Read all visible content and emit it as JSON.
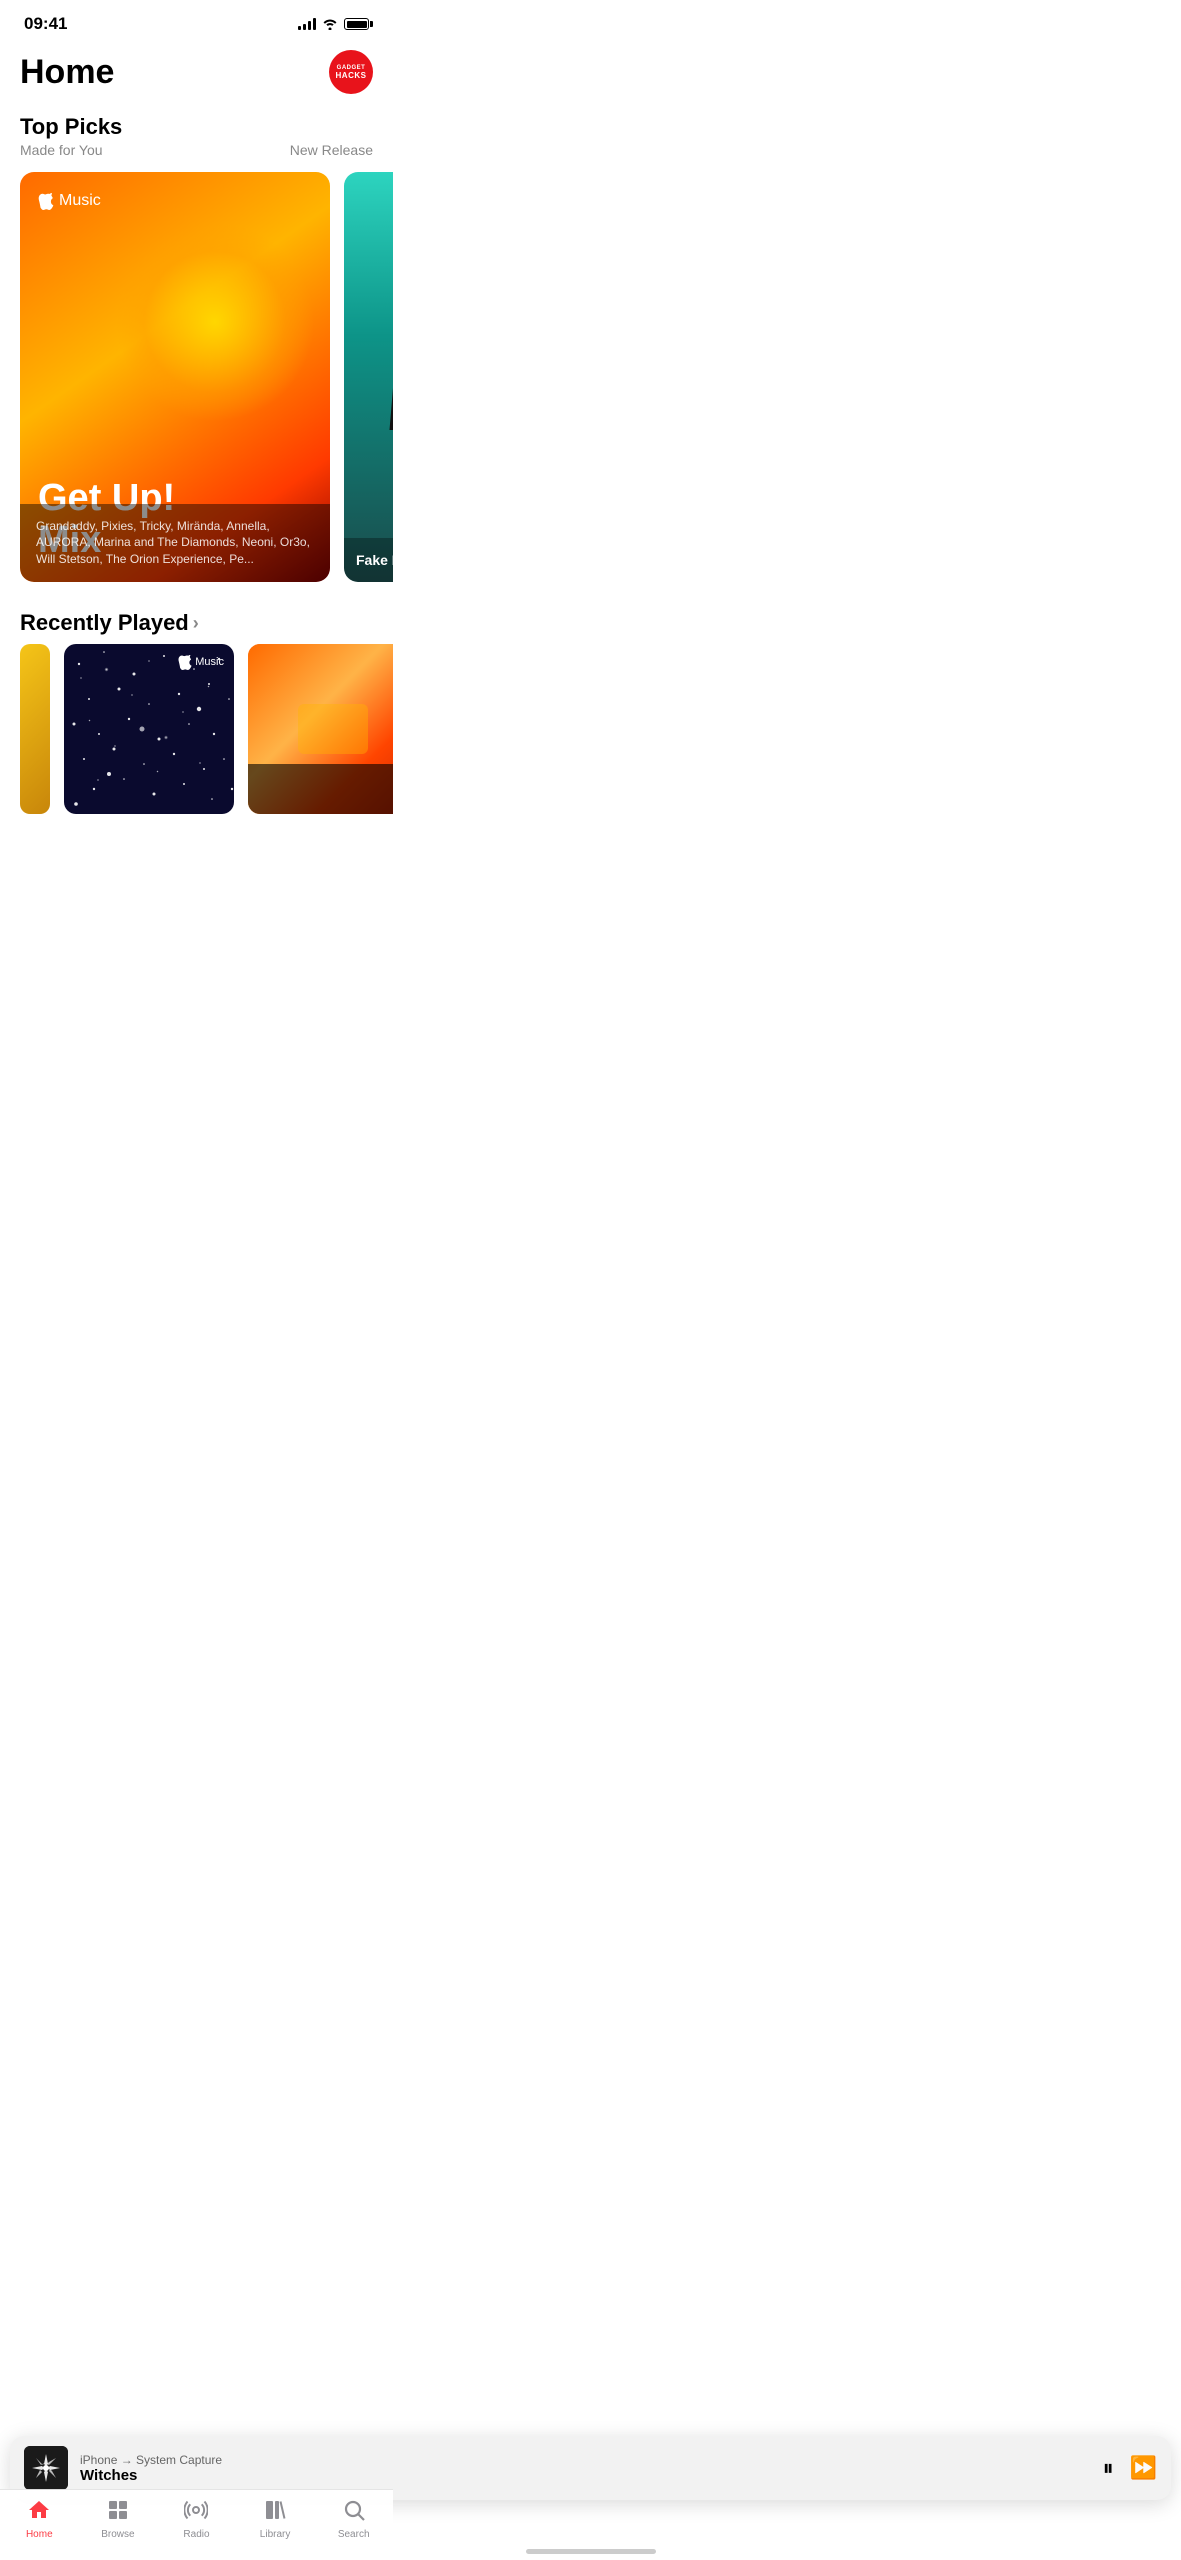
{
  "statusBar": {
    "time": "09:41"
  },
  "header": {
    "title": "Home",
    "avatar": {
      "line1": "GADGET",
      "line2": "HACKS"
    }
  },
  "topPicks": {
    "sectionTitle": "Top Picks",
    "subtitle": "Made for You",
    "rightLink": "New Release",
    "mainCard": {
      "appleMusicLabel": "Music",
      "title": "Get Up!\nMix",
      "description": "Grandaddy, Pixies, Tricky, Mirända, Annella, AURORA, Marina and The Diamonds, Neoni, Or3o, Will Stetson, The Orion Experience, Pe..."
    },
    "secondaryCard": {
      "text": "Fake Is T..."
    }
  },
  "recentlyPlayed": {
    "title": "Recently Played"
  },
  "nowPlaying": {
    "route": "iPhone → System Capture",
    "title": "Witches"
  },
  "tabBar": {
    "tabs": [
      {
        "id": "home",
        "label": "Home",
        "active": true
      },
      {
        "id": "browse",
        "label": "Browse",
        "active": false
      },
      {
        "id": "radio",
        "label": "Radio",
        "active": false
      },
      {
        "id": "library",
        "label": "Library",
        "active": false
      },
      {
        "id": "search",
        "label": "Search",
        "active": false
      }
    ]
  }
}
